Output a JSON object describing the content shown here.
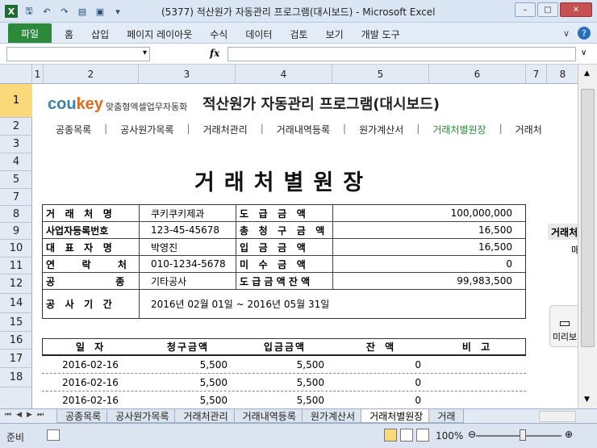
{
  "window": {
    "title": "(5377) 적산원가 자동관리 프로그램(대시보드)  -  Microsoft Excel",
    "min_icon": "minimize-icon",
    "max_icon": "maximize-icon",
    "close_icon": "close-icon"
  },
  "ribbon": {
    "file_tab": "파일",
    "tabs": [
      "홈",
      "삽입",
      "페이지 레이아웃",
      "수식",
      "데이터",
      "검토",
      "보기",
      "개발 도구"
    ]
  },
  "formula_bar": {
    "name_box": "",
    "fx_label": "fx",
    "value": ""
  },
  "columns": [
    "1",
    "2",
    "3",
    "4",
    "5",
    "6",
    "7",
    "8"
  ],
  "rows": [
    "1",
    "2",
    "3",
    "4",
    "5",
    "7",
    "8",
    "9",
    "10",
    "11",
    "12",
    "14",
    "15",
    "16",
    "17",
    "18"
  ],
  "header": {
    "logo_main": "cou",
    "logo_key": "key",
    "tagline": "맞춤형엑셀업무자동화",
    "app_title": "적산원가 자동관리 프로그램(대시보드)"
  },
  "nav": {
    "items": [
      "공종목록",
      "공사원가목록",
      "거래처관리",
      "거래내역등록",
      "원가계산서",
      "거래처별원장",
      "거래처"
    ],
    "active_index": 5,
    "separator": "|"
  },
  "page_title": "거래처별원장",
  "info": {
    "rows": [
      {
        "label": "거   래   처   명",
        "value": "쿠키쿠키제과",
        "label2": "도   급   금   액",
        "value2": "100,000,000"
      },
      {
        "label": "사업자등록번호",
        "value": "123-45-45678",
        "label2": "총   청   구   금   액",
        "value2": "16,500"
      },
      {
        "label": "대   표   자   명",
        "value": "박영진",
        "label2": "입   금   금   액",
        "value2": "16,500"
      },
      {
        "label": "연        락        처",
        "value": "010-1234-5678",
        "label2": "미   수   금   액",
        "value2": "0"
      },
      {
        "label": "공                  종",
        "value": "기타공사",
        "label2": "도 급 금 액 잔 액",
        "value2": "99,983,500"
      }
    ],
    "period_label": "공   사   기   간",
    "period_value": "2016년 02월 01일  ~  2016년 05월 31일"
  },
  "ledger": {
    "headers": [
      "일 자",
      "청구금액",
      "입금금액",
      "잔 액",
      "비 고"
    ],
    "rows": [
      {
        "date": "2016-02-16",
        "billed": "5,500",
        "received": "5,500",
        "balance": "0",
        "note": ""
      },
      {
        "date": "2016-02-16",
        "billed": "5,500",
        "received": "5,500",
        "balance": "0",
        "note": ""
      },
      {
        "date": "2016-02-16",
        "billed": "5,500",
        "received": "5,500",
        "balance": "0",
        "note": ""
      }
    ]
  },
  "side_panel": {
    "header": "거래처",
    "value": "매",
    "button_label": "미리보"
  },
  "sheet_tabs": {
    "tabs": [
      "공종목록",
      "공사원가목록",
      "거래처관리",
      "거래내역등록",
      "원가계산서",
      "거래처별원장",
      "거래"
    ],
    "active_index": 5
  },
  "status": {
    "ready": "준비",
    "zoom": "100%"
  },
  "colors": {
    "file_tab": "#2a8a3a",
    "active_nav": "#2a8a3a",
    "logo_blue": "#3e7fa9",
    "logo_orange": "#e06b1e"
  }
}
